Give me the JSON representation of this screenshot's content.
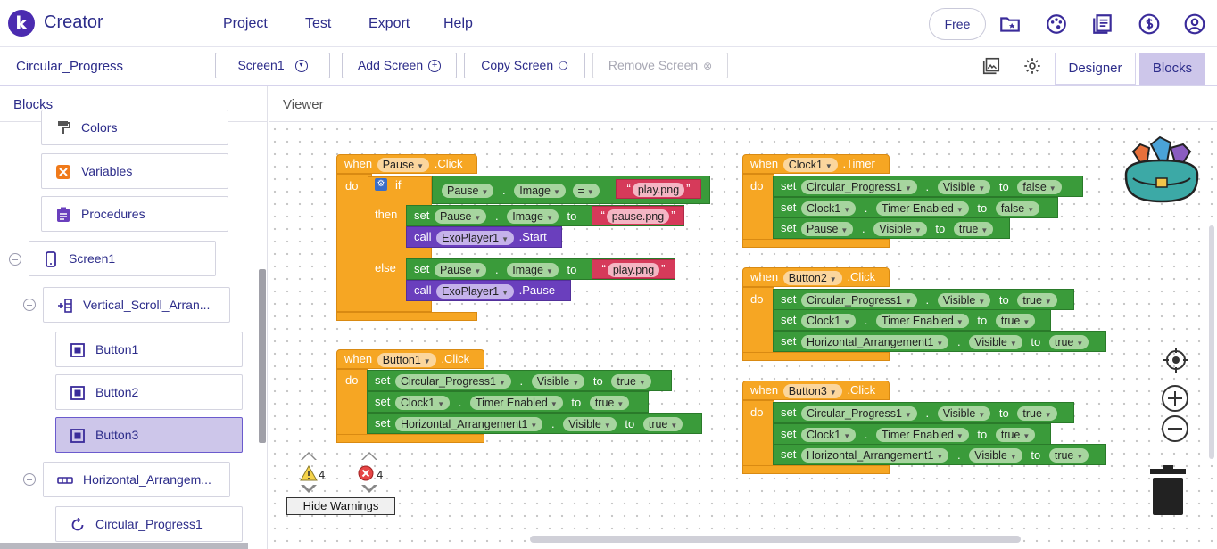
{
  "app": {
    "logo_letter": "k",
    "name": "Creator"
  },
  "nav": {
    "items": [
      "Project",
      "Test",
      "Export",
      "Help"
    ],
    "free_label": "Free"
  },
  "toolbar": {
    "project_name": "Circular_Progress",
    "screen_select": "Screen1",
    "add_screen": "Add Screen",
    "copy_screen": "Copy Screen",
    "remove_screen": "Remove Screen",
    "designer": "Designer",
    "blocks": "Blocks"
  },
  "left_panel": {
    "title": "Blocks",
    "items": [
      {
        "label": "Colors",
        "icon": "paint-roller-icon"
      },
      {
        "label": "Variables",
        "icon": "variables-icon"
      },
      {
        "label": "Procedures",
        "icon": "procedures-icon"
      },
      {
        "label": "Screen1",
        "icon": "phone-icon"
      },
      {
        "label": "Vertical_Scroll_Arran...",
        "icon": "vertical-arrangement-icon"
      },
      {
        "label": "Button1",
        "icon": "button-icon"
      },
      {
        "label": "Button2",
        "icon": "button-icon"
      },
      {
        "label": "Button3",
        "icon": "button-icon",
        "selected": true
      },
      {
        "label": "Horizontal_Arrangem...",
        "icon": "horizontal-arrangement-icon"
      },
      {
        "label": "Circular_Progress1",
        "icon": "progress-icon"
      }
    ]
  },
  "viewer": {
    "title": "Viewer"
  },
  "kw": {
    "when": "when",
    "do": "do",
    "if": "if",
    "then": "then",
    "else": "else",
    "set": "set",
    "call": "call",
    "to": "to",
    "dot": ".",
    "eq": "="
  },
  "blocks": {
    "pause_click": {
      "component": "Pause",
      "event": ".Click",
      "if_comp": "Pause",
      "if_prop": "Image",
      "if_val": "play.png",
      "then_comp": "Pause",
      "then_prop": "Image",
      "then_val": "pause.png",
      "then_call_comp": "ExoPlayer1",
      "then_call_method": ".Start",
      "else_comp": "Pause",
      "else_prop": "Image",
      "else_val": "play.png",
      "else_call_comp": "ExoPlayer1",
      "else_call_method": ".Pause"
    },
    "button1_click": {
      "component": "Button1",
      "event": ".Click",
      "rows": [
        {
          "comp": "Circular_Progress1",
          "prop": "Visible",
          "val": "true"
        },
        {
          "comp": "Clock1",
          "prop": "Timer Enabled",
          "val": "true"
        },
        {
          "comp": "Horizontal_Arrangement1",
          "prop": "Visible",
          "val": "true"
        }
      ]
    },
    "clock1_timer": {
      "component": "Clock1",
      "event": ".Timer",
      "rows": [
        {
          "comp": "Circular_Progress1",
          "prop": "Visible",
          "val": "false"
        },
        {
          "comp": "Clock1",
          "prop": "Timer Enabled",
          "val": "false"
        },
        {
          "comp": "Pause",
          "prop": "Visible",
          "val": "true"
        }
      ]
    },
    "button2_click": {
      "component": "Button2",
      "event": ".Click",
      "rows": [
        {
          "comp": "Circular_Progress1",
          "prop": "Visible",
          "val": "true"
        },
        {
          "comp": "Clock1",
          "prop": "Timer Enabled",
          "val": "true"
        },
        {
          "comp": "Horizontal_Arrangement1",
          "prop": "Visible",
          "val": "true"
        }
      ]
    },
    "button3_click": {
      "component": "Button3",
      "event": ".Click",
      "rows": [
        {
          "comp": "Circular_Progress1",
          "prop": "Visible",
          "val": "true"
        },
        {
          "comp": "Clock1",
          "prop": "Timer Enabled",
          "val": "true"
        },
        {
          "comp": "Horizontal_Arrangement1",
          "prop": "Visible",
          "val": "true"
        }
      ]
    }
  },
  "warnings": {
    "warning_count": "4",
    "error_count": "4",
    "hide_label": "Hide Warnings"
  },
  "colors": {
    "accent": "#4b2bb0",
    "event": "#f6a623",
    "set": "#3a9b3a",
    "call": "#6a3fbd",
    "text": "#d63a5a"
  }
}
